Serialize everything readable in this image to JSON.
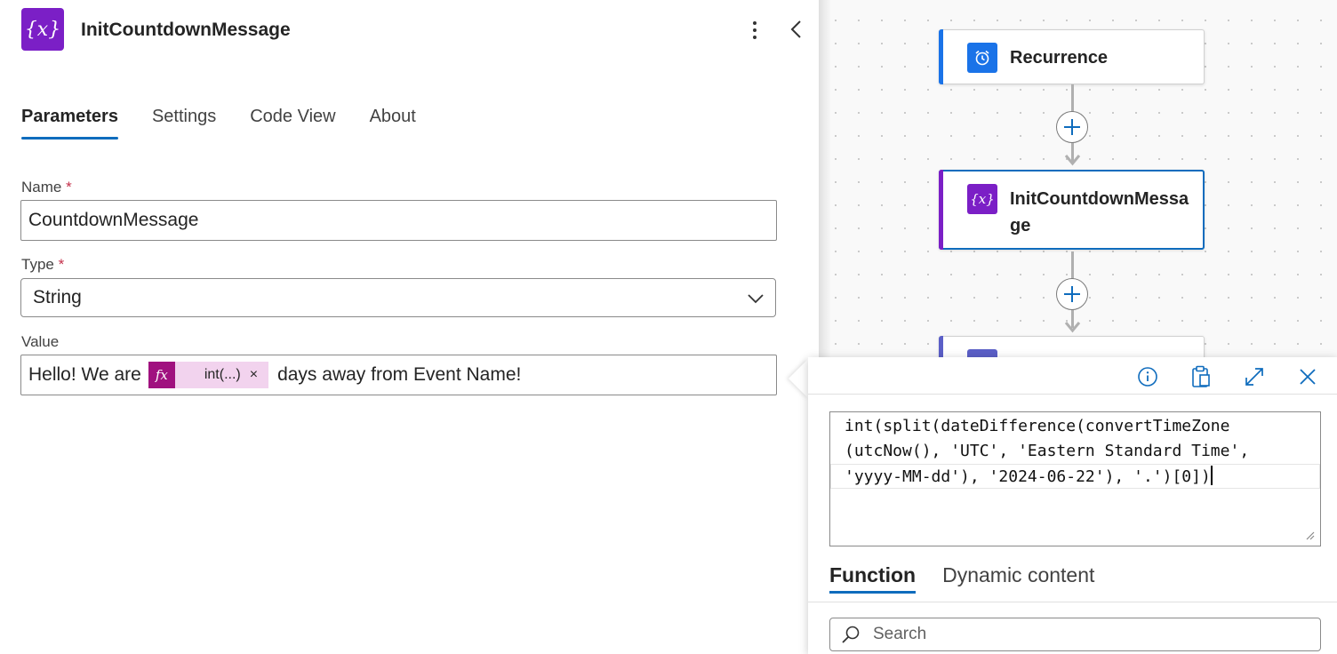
{
  "panel": {
    "title": "InitCountdownMessage",
    "icon": "variable-icon",
    "icon_text": "{x}",
    "tabs": [
      {
        "label": "Parameters",
        "active": true
      },
      {
        "label": "Settings",
        "active": false
      },
      {
        "label": "Code View",
        "active": false
      },
      {
        "label": "About",
        "active": false
      }
    ],
    "fields": {
      "name": {
        "label": "Name",
        "required_mark": "*",
        "value": "CountdownMessage"
      },
      "type": {
        "label": "Type",
        "required_mark": "*",
        "value": "String"
      },
      "value": {
        "label": "Value",
        "text_before": "Hello! We are",
        "token_label": "int(...)",
        "token_icon_text": "fx",
        "token_remove": "×",
        "text_after": "days away from Event Name!"
      }
    }
  },
  "canvas": {
    "nodes": [
      {
        "label": "Recurrence",
        "icon": "alarm-clock-icon",
        "accent": "#1a73e8"
      },
      {
        "label_line1": "InitCountdownMessa",
        "label_line2": "ge",
        "icon": "variable-icon",
        "icon_text": "{x}",
        "accent": "#7b1fc6",
        "selected": true
      }
    ]
  },
  "expression_editor": {
    "toolbar_icons": [
      "info-icon",
      "clipboard-icon",
      "expand-icon",
      "close-icon"
    ],
    "lines": [
      "int(split(dateDifference(convertTimeZone",
      "(utcNow(), 'UTC', 'Eastern Standard Time',",
      "'yyyy-MM-dd'), '2024-06-22'), '.')[0])"
    ],
    "tabs": [
      {
        "label": "Function",
        "active": true
      },
      {
        "label": "Dynamic content",
        "active": false
      }
    ],
    "search_placeholder": "Search"
  },
  "colors": {
    "accent_blue": "#0f6cbd",
    "variable_purple": "#7b1fc6",
    "token_magenta": "#a0117f",
    "token_bg": "#f2d3ee"
  }
}
